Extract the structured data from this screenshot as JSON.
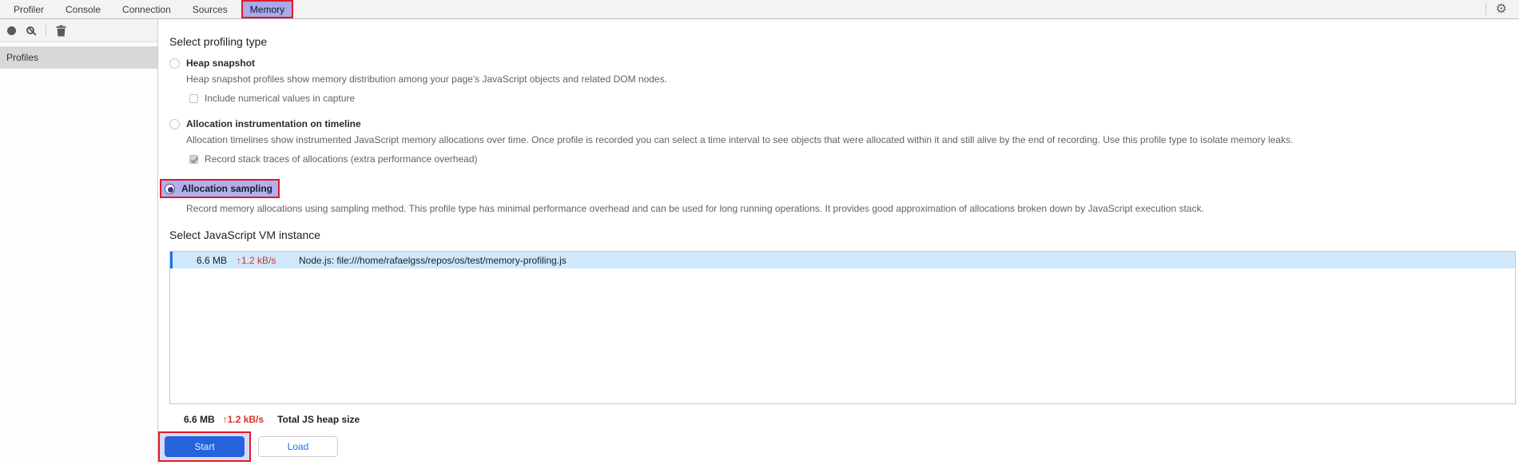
{
  "tabbar": {
    "tabs": [
      "Profiler",
      "Console",
      "Connection",
      "Sources",
      "Memory"
    ],
    "active_tab": "Memory"
  },
  "icons": {
    "record": "record-icon",
    "clear": "clear-icon",
    "trash": "delete-profile-icon",
    "gear_glyph": "⚙"
  },
  "sidebar": {
    "profiles_label": "Profiles"
  },
  "profiling": {
    "heading": "Select profiling type",
    "options": [
      {
        "label": "Heap snapshot",
        "selected": false,
        "description": "Heap snapshot profiles show memory distribution among your page's JavaScript objects and related DOM nodes.",
        "checkbox": {
          "label": "Include numerical values in capture",
          "checked": false
        }
      },
      {
        "label": "Allocation instrumentation on timeline",
        "selected": false,
        "description": "Allocation timelines show instrumented JavaScript memory allocations over time. Once profile is recorded you can select a time interval to see objects that were allocated within it and still alive by the end of recording. Use this profile type to isolate memory leaks.",
        "checkbox": {
          "label": "Record stack traces of allocations (extra performance overhead)",
          "checked": true
        }
      },
      {
        "label": "Allocation sampling",
        "selected": true,
        "highlighted": true,
        "description": "Record memory allocations using sampling method. This profile type has minimal performance overhead and can be used for long running operations. It provides good approximation of allocations broken down by JavaScript execution stack."
      }
    ]
  },
  "vm": {
    "heading": "Select JavaScript VM instance",
    "rows": [
      {
        "heap_size": "6.6 MB",
        "rate": "↑1.2 kB/s",
        "name": "Node.js: file:///home/rafaelgss/repos/os/test/memory-profiling.js",
        "selected": true
      }
    ],
    "total": {
      "heap_size": "6.6 MB",
      "rate": "↑1.2 kB/s",
      "label": "Total JS heap size"
    }
  },
  "actions": {
    "start": "Start",
    "load": "Load"
  },
  "colors": {
    "annotation_red": "#e01b24",
    "highlight_lavender": "#aaaaec",
    "selected_row_blue": "#cfe8fc",
    "row_stripe_blue": "#1a73e8",
    "rate_red": "#d93025",
    "start_button_blue": "#2563dd",
    "link_blue": "#1a73e8"
  }
}
